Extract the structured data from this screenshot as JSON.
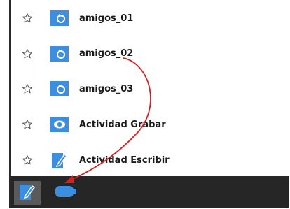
{
  "list": {
    "items": [
      {
        "name": "amigos_01",
        "icon": "document-icon"
      },
      {
        "name": "amigos_02",
        "icon": "document-icon"
      },
      {
        "name": "amigos_03",
        "icon": "document-icon"
      },
      {
        "name": "Actividad Grabar",
        "icon": "record-activity-icon"
      },
      {
        "name": "Actividad Escribir",
        "icon": "write-activity-icon"
      }
    ]
  },
  "taskbar": {
    "items": [
      {
        "icon": "journal-icon",
        "selected": true
      },
      {
        "icon": "usb-drive-icon",
        "selected": false
      }
    ]
  },
  "colors": {
    "icon_blue": "#3b8ee0",
    "annotation_red": "#d42020",
    "taskbar_bg": "#262626"
  }
}
